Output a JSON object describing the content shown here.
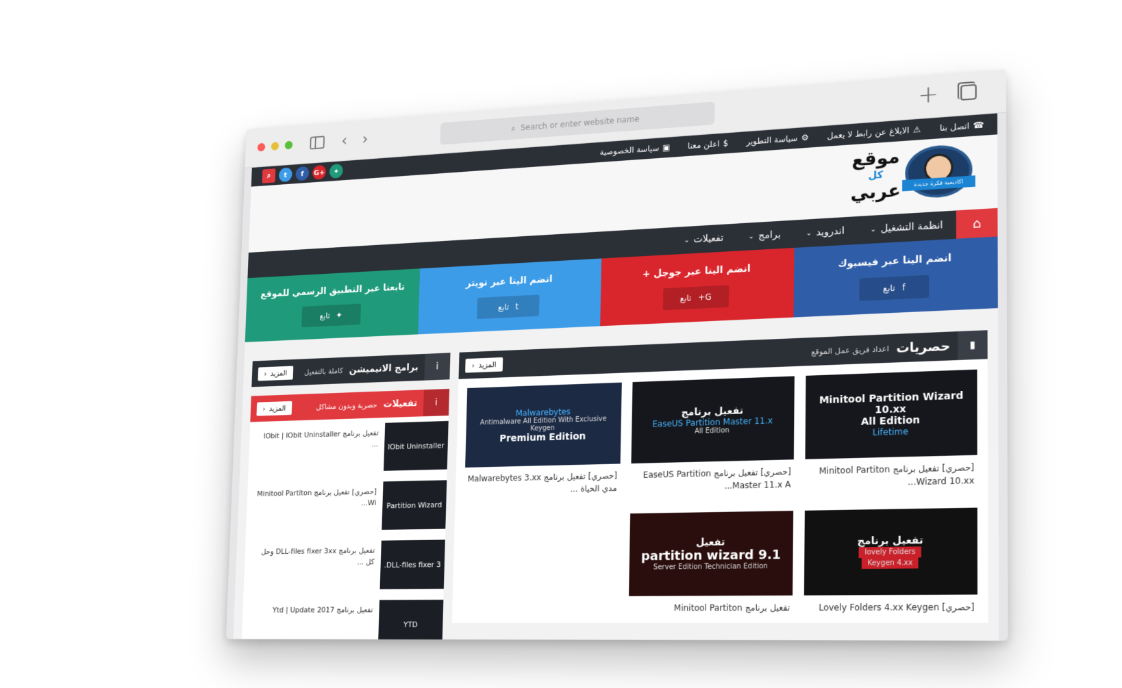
{
  "browser": {
    "url_placeholder": "Search or enter website name",
    "plus_label": "+"
  },
  "topbar": {
    "items": [
      {
        "icon": "phone-icon",
        "label": "اتصل بنا"
      },
      {
        "icon": "warning-icon",
        "label": "الابلاغ عن رابط لا يعمل"
      },
      {
        "icon": "gear-icon",
        "label": "سياسة التطوير"
      },
      {
        "icon": "dollar-icon",
        "label": "اعلن معنا"
      },
      {
        "icon": "lock-icon",
        "label": "سياسة الخصوصية"
      }
    ],
    "social": [
      {
        "icon": "search-icon",
        "glyph": "⌕",
        "color": "#e0393e"
      },
      {
        "icon": "twitter-icon",
        "glyph": "t",
        "color": "#3d9ce8"
      },
      {
        "icon": "facebook-icon",
        "glyph": "f",
        "color": "#2f5da8"
      },
      {
        "icon": "google-plus-icon",
        "glyph": "G+",
        "color": "#d9262d"
      },
      {
        "icon": "android-icon",
        "glyph": "✦",
        "color": "#1f9a7a"
      }
    ]
  },
  "header": {
    "logo_top": "موقع",
    "logo_mid": "كل",
    "logo_bottom": "عربي",
    "badge_ribbon": "اكاديمية فكرة جديدة"
  },
  "nav": {
    "home_icon": "home-icon",
    "items": [
      "انظمة التشغيل",
      "اندرويد",
      "برامج",
      "تفعيلات"
    ]
  },
  "follow": [
    {
      "title": "انضم الينا عبر فيسبوك",
      "button": "تابع",
      "glyph": "f",
      "icon": "facebook-icon",
      "color": "#2f5da8"
    },
    {
      "title": "انضم الينا عبر جوجل +",
      "button": "تابع",
      "glyph": "G+",
      "icon": "google-plus-icon",
      "color": "#d9262d"
    },
    {
      "title": "انضم الينا عبر تويتر",
      "button": "تابع",
      "glyph": "t",
      "icon": "twitter-icon",
      "color": "#3d9ce8"
    },
    {
      "title": "تابعنا عبر التطبيق الرسمي للموقع",
      "button": "تابع",
      "glyph": "✦",
      "icon": "android-icon",
      "color": "#1f9a7a"
    }
  ],
  "main_section": {
    "title": "حصريات",
    "subtitle": "اعداد فريق عمل الموقع",
    "more": "المزيد",
    "cards": [
      {
        "thumb_line1": "Minitool Partition Wizard 10.xx",
        "thumb_line2": "All Edition",
        "thumb_line3": "Lifetime",
        "title": "[حصري] تفعيل برنامج Minitool Partiton Wizard 10.xx..."
      },
      {
        "thumb_line1": "تفعيل برنامج",
        "thumb_line2": "EaseUS Partition Master 11.x",
        "thumb_line3": "All Edition",
        "title": "[حصري] تفعيل برنامج EaseUS Partition Master 11.x A..."
      },
      {
        "thumb_line1": "Malwarebytes",
        "thumb_line2": "Antimalware All Edition With Exclusive Keygen",
        "thumb_line3": "Premium Edition",
        "title": "[حصري] تفعيل برنامج Malwarebytes 3.xx مدي الحياة ..."
      },
      {
        "thumb_line1": "تفعيل برنامج",
        "thumb_line2": "lovely Folders",
        "thumb_line3": "Keygen 4.xx",
        "title": "[حصري] Lovely Folders 4.xx Keygen"
      },
      {
        "thumb_line1": "تفعيل",
        "thumb_line2": "partition wizard 9.1",
        "thumb_line3": "Server Edition Technician Edition",
        "title": "تفعيل برنامج Minitool Partiton"
      }
    ]
  },
  "side_section1": {
    "title": "برامج الانيميشن",
    "subtitle": "كاملة بالتفعيل",
    "more": "المزيد"
  },
  "side_section2": {
    "title": "تفعيلات",
    "subtitle": "حصرية وبدون مشاكل",
    "more": "المزيد",
    "items": [
      {
        "thumb": "IObit Uninstaller",
        "text": "تفعيل برنامج IObit | IObit Uninstaller ..."
      },
      {
        "thumb": "Partition Wizard",
        "text": "[حصري] تفعيل برنامج Minitool Partiton Wi..."
      },
      {
        "thumb": "DLL-files fixer 3.",
        "text": "تفعيل برنامج DLL-files fixer 3xx وحل كل ..."
      },
      {
        "thumb": "YTD",
        "text": "تفعيل برنامج Ytd | Update 2017"
      }
    ]
  }
}
